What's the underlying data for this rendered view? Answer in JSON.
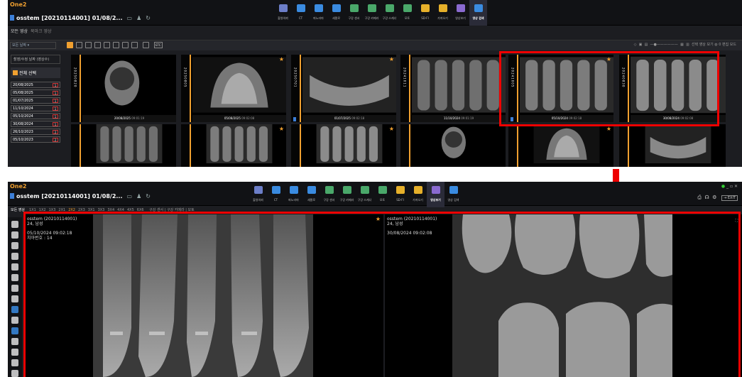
{
  "app_name": "One2",
  "patient": {
    "title": "osstem  [20210114001] 01/08/2..."
  },
  "nav": [
    {
      "label": "촬영의뢰",
      "color": "#6c7ec8"
    },
    {
      "label": "CT",
      "color": "#3a8be0"
    },
    {
      "label": "파노라마",
      "color": "#3a8be0"
    },
    {
      "label": "세팔로",
      "color": "#3a8be0"
    },
    {
      "label": "구강 센서",
      "color": "#4aa86a"
    },
    {
      "label": "구강 카메라",
      "color": "#4aa86a"
    },
    {
      "label": "구강 스캐너",
      "color": "#4aa86a"
    },
    {
      "label": "모토",
      "color": "#4aa86a"
    },
    {
      "label": "SD-FI",
      "color": "#e6b02a"
    },
    {
      "label": "가져오기",
      "color": "#e6b02a"
    },
    {
      "label": "영상보기",
      "color": "#8a6ad0"
    },
    {
      "label": "영상 검색",
      "color": "#3a8be0"
    }
  ],
  "top": {
    "subtitle": "모든 영상",
    "subtitle_sub": "북마크 영상",
    "dropdown": "모든 날짜",
    "etc": "ETC",
    "right_tools": "선택 영상 보기  ◍ 0  편집 모드",
    "sidebar_header": "촬영/수정 날짜 (영상수)",
    "select_all": "전체 선택",
    "dates": [
      {
        "d": "20/08/2025",
        "n": "1"
      },
      {
        "d": "05/08/2025",
        "n": "1"
      },
      {
        "d": "01/07/2025",
        "n": "1"
      },
      {
        "d": "11/10/2024",
        "n": "1"
      },
      {
        "d": "05/10/2024",
        "n": "1"
      },
      {
        "d": "30/08/2024",
        "n": "1"
      },
      {
        "d": "26/10/2023",
        "n": "2"
      },
      {
        "d": "05/10/2023",
        "n": "2"
      }
    ],
    "thumbs": [
      {
        "strip": "20250820",
        "cap": "20/08/2025",
        "time": "09:01:19"
      },
      {
        "strip": "20250805",
        "cap": "05/08/2025",
        "time": "09:02:08"
      },
      {
        "strip": "20250701",
        "cap": "01/07/2025",
        "time": "09:02:18"
      },
      {
        "strip": "20241011",
        "cap": "11/10/2024",
        "time": "09:01:19"
      },
      {
        "strip": "20241005",
        "cap": "05/10/2024",
        "time": "09:02:18"
      },
      {
        "strip": "20240830",
        "cap": "30/08/2024",
        "time": "09:02:08"
      }
    ]
  },
  "bottom": {
    "layout_label": "모든 영상",
    "layouts": [
      "1X1",
      "1X2",
      "1X3",
      "2X1",
      "2X2",
      "2X3",
      "3X1",
      "3X3",
      "3X4",
      "4X4",
      "4X5",
      "6X6"
    ],
    "active_layout": "2X2",
    "filters": "구강 센서  |  구강 카메라  |  모토",
    "exit": "EXIT",
    "left_view": {
      "name": "osstem (20210114001)",
      "age": "24, 남성",
      "date": "05/10/2024 09:02:18",
      "tooth": "치아번호 : 14"
    },
    "right_view": {
      "name": "osstem (20210114001)",
      "age": "24, 남성",
      "date": "30/08/2024 09:02:08"
    }
  }
}
